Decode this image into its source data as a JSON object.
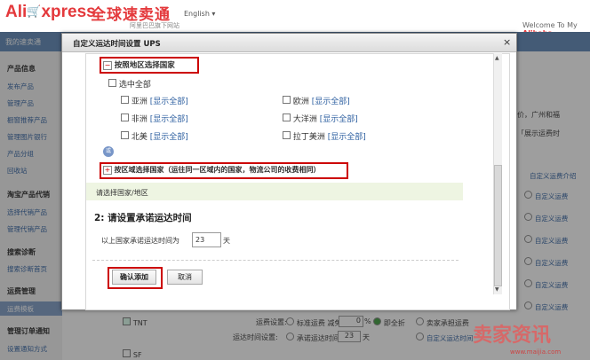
{
  "header": {
    "logo_ali": "Ali",
    "logo_express": "xpress",
    "logo_cn": "全球速卖通",
    "logo_sub": "阿里巴巴旗下网站",
    "language": "English ▾",
    "welcome_prefix": "Welcome To My",
    "welcome_brand": "Alibaba ▸"
  },
  "nav": {
    "my_store": "我的速卖通"
  },
  "sidebar": {
    "groups": [
      {
        "title": "产品信息",
        "items": [
          "发布产品",
          "管理产品",
          "橱窗推荐产品",
          "管理图片银行",
          "产品分组",
          "回收站"
        ]
      },
      {
        "title": "淘宝产品代销",
        "items": [
          "选择代销产品",
          "管理代销产品"
        ]
      },
      {
        "title": "搜索诊断",
        "items": [
          "搜索诊断首页"
        ]
      },
      {
        "title": "运费管理",
        "items": [
          "运费模板"
        ]
      },
      {
        "title": "管理订单通知",
        "items": [
          "设置通知方式"
        ]
      }
    ]
  },
  "bg_right": {
    "text1": "价，广州和福",
    "text2": "「展示运费时",
    "intro_link": "自定义运费介绍",
    "radio_labels": [
      "自定义运费",
      "自定义运费",
      "自定义运费",
      "自定义运费",
      "自定义运费",
      "自定义运费"
    ]
  },
  "bg_bottom": {
    "tnt_label": "TNT",
    "sf_label": "SF",
    "fee_setting_label": "运费设置:",
    "standard_fee": "标准运费 减免",
    "discount_value": "0",
    "percent": "%",
    "free_shipping": "即全折",
    "seller_fee": "卖家承担运费",
    "custom_fee": "自定义运费",
    "time_setting_label": "运达时间设置:",
    "promise_time": "承诺运达时间",
    "days_value": "23",
    "days_unit": "天",
    "custom_time": "自定义运达时间"
  },
  "modal": {
    "title": "自定义运达时间设置 UPS",
    "close": "×",
    "by_region_toggle": "−",
    "by_region_label": "按照地区选择国家",
    "select_all": "选中全部",
    "regions": [
      {
        "name": "亚洲",
        "link": "[显示全部]"
      },
      {
        "name": "欧洲",
        "link": "[显示全部]"
      },
      {
        "name": "非洲",
        "link": "[显示全部]"
      },
      {
        "name": "大洋洲",
        "link": "[显示全部]"
      },
      {
        "name": "北美",
        "link": "[显示全部]"
      },
      {
        "name": "拉丁美洲",
        "link": "[显示全部]"
      }
    ],
    "or_badge": "或",
    "by_zone_toggle": "+",
    "by_zone_label": "按区域选择国家（运往同一区域内的国家，物流公司的收费相同）",
    "select_hint": "请选择国家/地区",
    "step2_title": "2: 请设置承诺运达时间",
    "promise_prefix": "以上国家承诺运达时间为",
    "promise_days": "23",
    "promise_unit": "天",
    "confirm_button": "确认添加",
    "cancel_button": "取消"
  },
  "watermark": {
    "text": "卖家资讯",
    "url": "www.maijia.com"
  }
}
